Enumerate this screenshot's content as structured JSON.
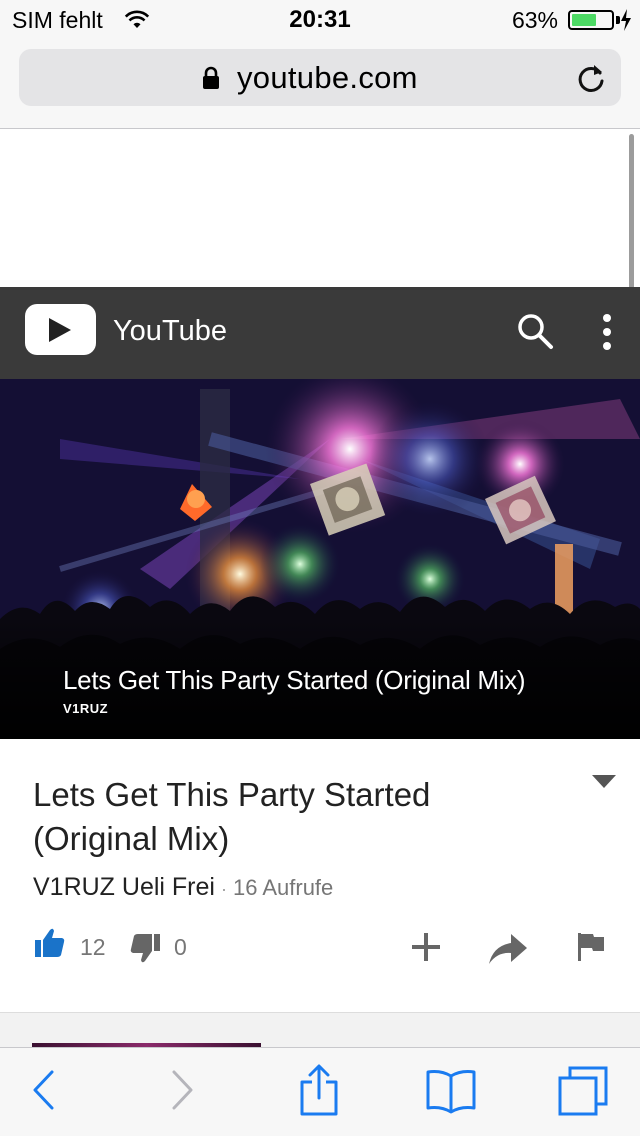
{
  "status_bar": {
    "carrier": "SIM fehlt",
    "time": "20:31",
    "battery_percent": "63%",
    "battery_level": 0.63,
    "battery_color": "#4cd964"
  },
  "safari": {
    "url": "youtube.com"
  },
  "youtube": {
    "header_title": "YouTube",
    "header_color": "#3a3a3a",
    "video": {
      "overlay_title": "Lets Get This Party Started (Original Mix)",
      "overlay_channel": "V1RUZ"
    },
    "info": {
      "title": "Lets Get This Party Started (Original Mix)",
      "channel": "V1RUZ Ueli Frei",
      "separator": "·",
      "views": "16 Aufrufe",
      "likes": "12",
      "dislikes": "0"
    },
    "accent_like_color": "#1a73c9"
  },
  "icons": {
    "lock": "lock-icon",
    "reload": "reload-icon",
    "search": "search-icon",
    "more": "more-vert-icon",
    "like": "thumbs-up-icon",
    "dislike": "thumbs-down-icon",
    "add": "add-to-playlist-icon",
    "share": "share-icon",
    "flag": "flag-icon",
    "back": "back-chevron-icon",
    "forward": "forward-chevron-icon",
    "share_sheet": "share-sheet-icon",
    "bookmarks": "bookmarks-icon",
    "tabs": "tabs-icon"
  }
}
